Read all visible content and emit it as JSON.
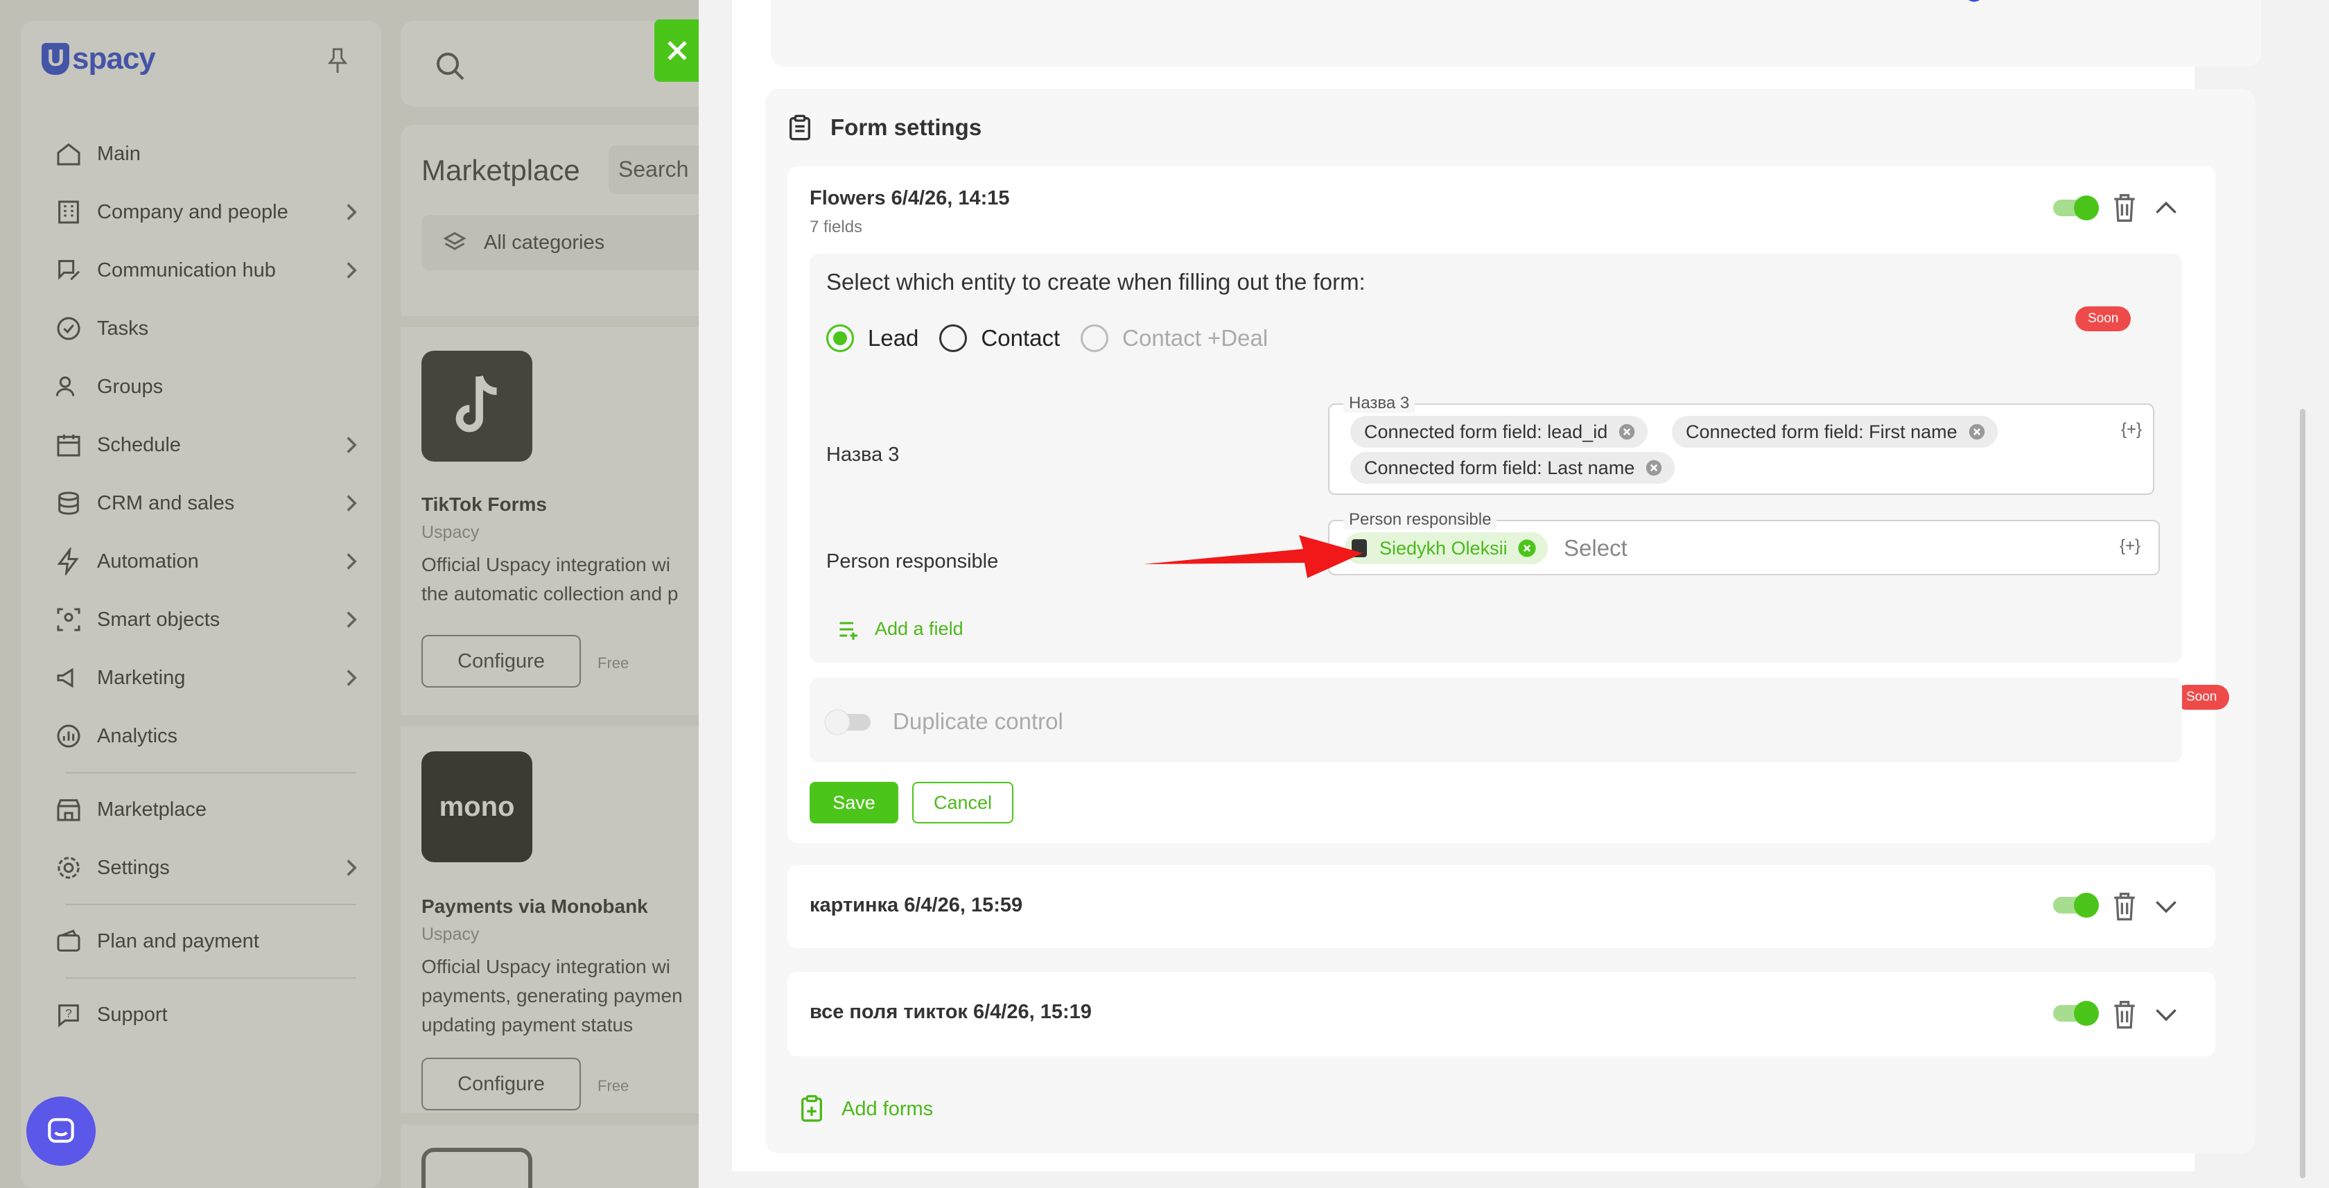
{
  "brand": {
    "logo_text": "spacy",
    "logo_letter": "U"
  },
  "sidebar": {
    "items": [
      {
        "label": "Main",
        "icon": "home-icon",
        "has_submenu": false
      },
      {
        "label": "Company and people",
        "icon": "building-icon",
        "has_submenu": true
      },
      {
        "label": "Communication hub",
        "icon": "chat-edit-icon",
        "has_submenu": true
      },
      {
        "label": "Tasks",
        "icon": "check-circle-icon",
        "has_submenu": false
      },
      {
        "label": "Groups",
        "icon": "users-icon",
        "has_submenu": false
      },
      {
        "label": "Schedule",
        "icon": "calendar-icon",
        "has_submenu": true
      },
      {
        "label": "CRM and sales",
        "icon": "coins-icon",
        "has_submenu": true
      },
      {
        "label": "Automation",
        "icon": "lightning-icon",
        "has_submenu": true
      },
      {
        "label": "Smart objects",
        "icon": "smart-object-icon",
        "has_submenu": true
      },
      {
        "label": "Marketing",
        "icon": "megaphone-icon",
        "has_submenu": true
      },
      {
        "label": "Analytics",
        "icon": "chart-icon",
        "has_submenu": false
      }
    ],
    "bottom_items": [
      {
        "label": "Marketplace",
        "icon": "store-icon"
      },
      {
        "label": "Settings",
        "icon": "gear-icon"
      },
      {
        "label": "Plan and payment",
        "icon": "wallet-icon"
      },
      {
        "label": "Support",
        "icon": "question-icon"
      }
    ]
  },
  "marketplace": {
    "title": "Marketplace",
    "search_placeholder": "Search",
    "category": "All categories",
    "cards": [
      {
        "title": "TikTok Forms",
        "vendor": "Uspacy",
        "desc_line1": "Official Uspacy integration wi",
        "desc_line2": "the automatic collection and p",
        "desc_line3": "",
        "button": "Configure",
        "price": "Free"
      },
      {
        "title": "Payments via Monobank",
        "vendor": "Uspacy",
        "logo_text": "mono",
        "desc_line1": "Official Uspacy integration wi",
        "desc_line2": "payments, generating paymen",
        "desc_line3": "updating payment status",
        "button": "Configure",
        "price": "Free"
      }
    ]
  },
  "form_settings": {
    "header": "Form settings",
    "forms": [
      {
        "title": "Flowers 6/4/26, 14:15",
        "subtitle": "7 fields",
        "enabled": true,
        "expanded": true
      },
      {
        "title": "картинка 6/4/26, 15:59",
        "enabled": true,
        "expanded": false
      },
      {
        "title": "все поля тикток 6/4/26, 15:19",
        "enabled": true,
        "expanded": false
      }
    ],
    "entity_question": "Select which entity to create when filling out the form:",
    "entity_options": [
      {
        "label": "Lead",
        "selected": true,
        "disabled": false
      },
      {
        "label": "Contact",
        "selected": false,
        "disabled": false
      },
      {
        "label": "Contact +Deal",
        "selected": false,
        "disabled": true
      }
    ],
    "soon_badge": "Soon",
    "field_name": {
      "label": "Назва 3",
      "legend": "Назва 3",
      "chips": [
        "Connected form field: lead_id",
        "Connected form field: First name",
        "Connected form field: Last name"
      ],
      "var_button": "{+}"
    },
    "person_responsible": {
      "label": "Person responsible",
      "legend": "Person responsible",
      "chip": "Siedykh Oleksii",
      "placeholder": "Select",
      "var_button": "{+}"
    },
    "add_field": "Add a field",
    "duplicate_control": "Duplicate control",
    "save": "Save",
    "cancel": "Cancel",
    "add_forms": "Add forms"
  },
  "colors": {
    "accent": "#4cc51a",
    "brand": "#1f3cd6",
    "soon": "#ef4a4a",
    "chat": "#5b57e8"
  }
}
